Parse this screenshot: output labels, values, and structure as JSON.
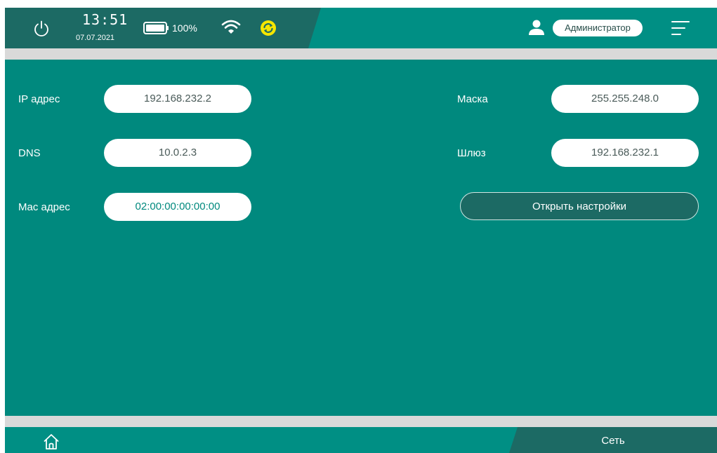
{
  "header": {
    "time": "13:51",
    "date": "07.07.2021",
    "battery_text": "100%",
    "user_role": "Администратор",
    "icons": [
      "power-icon",
      "battery-icon",
      "wifi-icon",
      "sync-icon",
      "user-icon",
      "menu-icon"
    ]
  },
  "network": {
    "ip_label": "IP адрес",
    "ip_value": "192.168.232.2",
    "mask_label": "Маска",
    "mask_value": "255.255.248.0",
    "dns_label": "DNS",
    "dns_value": "10.0.2.3",
    "gateway_label": "Шлюз",
    "gateway_value": "192.168.232.1",
    "mac_label": "Mac адрес",
    "mac_value": "02:00:00:00:00:00",
    "open_settings_label": "Открыть настройки"
  },
  "footer": {
    "active_tab": "Сеть",
    "home_icon": "home-icon"
  },
  "colors": {
    "background": "#00897e",
    "header_dark": "#1c6a64",
    "band": "#d9d9d9",
    "sync_icon": "#f5e600"
  }
}
